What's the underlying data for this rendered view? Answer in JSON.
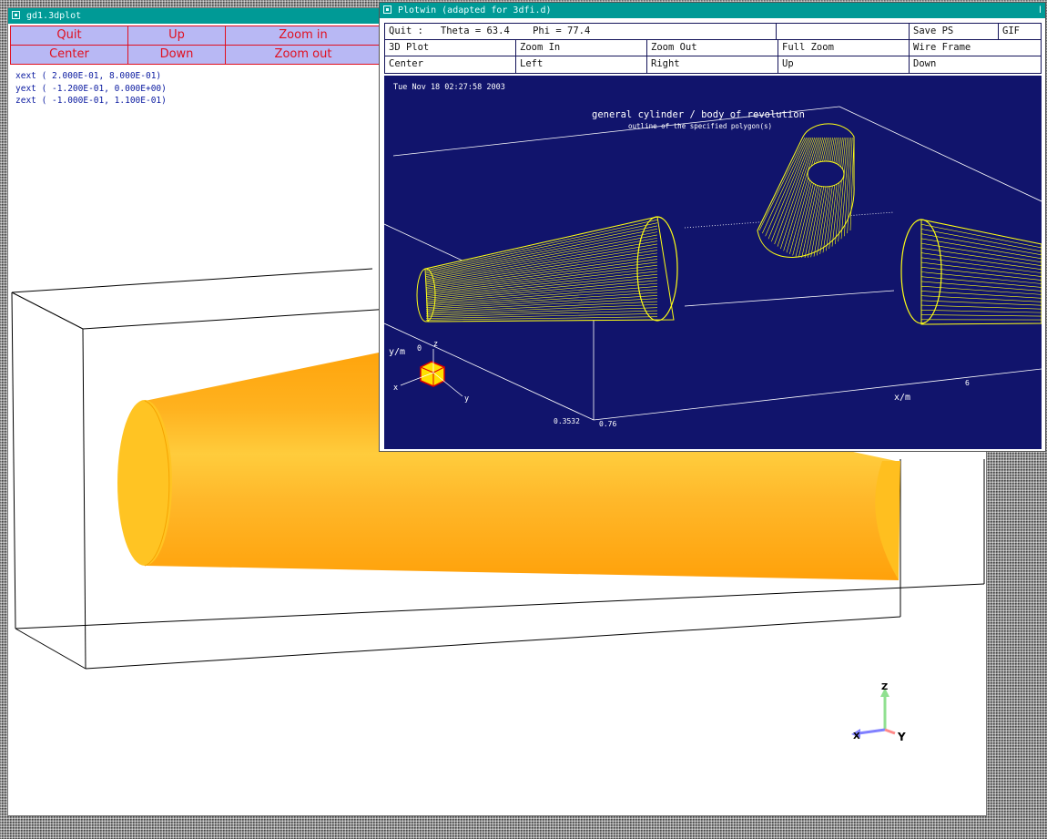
{
  "left_window": {
    "title": "gd1.3dplot",
    "buttons": [
      {
        "label": "Quit"
      },
      {
        "label": "Up"
      },
      {
        "label": "Zoom in"
      },
      {
        "label": "Center"
      },
      {
        "label": "Down"
      },
      {
        "label": "Zoom out"
      }
    ],
    "extents": [
      "xext ( 2.000E-01, 8.000E-01)",
      "yext ( -1.200E-01, 0.000E+00)",
      "zext ( -1.000E-01, 1.100E-01)"
    ],
    "axis_triad": {
      "z": "Z",
      "x": "X",
      "y": "Y"
    }
  },
  "right_window": {
    "title": "Plotwin (adapted for 3dfi.d)",
    "title_right": "Ⅰ",
    "menu": {
      "row1": {
        "quit": "Quit :",
        "theta": "Theta = 63.4",
        "phi": "Phi = 77.4",
        "save_ps": "Save PS",
        "gif": "GIF"
      },
      "row2": [
        "3D Plot",
        "Zoom In",
        "Zoom Out",
        "Full Zoom",
        "Wire Frame"
      ],
      "row3": [
        "Center",
        "Left",
        "Right",
        "Up",
        "Down"
      ]
    },
    "plot": {
      "timestamp": "Tue Nov 18 02:27:58 2003",
      "title": "general cylinder / body of revolution",
      "subtitle": "outline of the specified polygon(s)",
      "axis_labels": {
        "y": "y/m",
        "x": "x/m",
        "y_zero": "0",
        "z": "z",
        "triad_x": "x",
        "triad_y": "y"
      },
      "tick_labels": {
        "bottom_left": "0.3532",
        "x_start": "0.76",
        "x_right": "6"
      }
    }
  },
  "colors": {
    "titlebar": "#009a96",
    "button_bg": "#b8b8f4",
    "button_text": "#e01020",
    "plot_bg": "#11146c",
    "wire": "#ffff14",
    "cylinder": "#ffb21f"
  }
}
